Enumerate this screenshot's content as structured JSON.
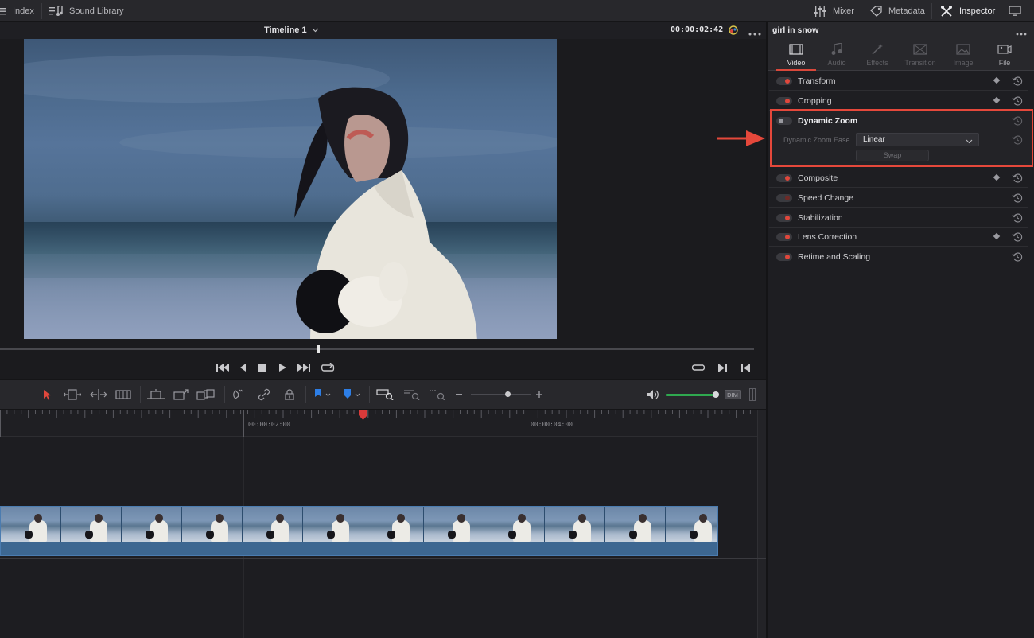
{
  "topbar": {
    "index_label": "Index",
    "sound_library_label": "Sound Library",
    "mixer_label": "Mixer",
    "metadata_label": "Metadata",
    "inspector_label": "Inspector"
  },
  "viewer": {
    "timeline_name": "Timeline 1",
    "timecode": "00:00:02:42"
  },
  "timeline": {
    "ruler_labels": [
      "00:00:02:00",
      "00:00:04:00"
    ]
  },
  "inspector": {
    "clip_name": "girl in snow",
    "tabs": [
      {
        "label": "Video",
        "active": true
      },
      {
        "label": "Audio",
        "active": false
      },
      {
        "label": "Effects",
        "active": false
      },
      {
        "label": "Transition",
        "active": false
      },
      {
        "label": "Image",
        "active": false
      },
      {
        "label": "File",
        "active": false
      }
    ],
    "sections": [
      {
        "label": "Transform"
      },
      {
        "label": "Cropping"
      },
      {
        "label": "Dynamic Zoom"
      },
      {
        "label": "Composite"
      },
      {
        "label": "Speed Change"
      },
      {
        "label": "Stabilization"
      },
      {
        "label": "Lens Correction"
      },
      {
        "label": "Retime and Scaling"
      }
    ],
    "dynamic_zoom": {
      "ease_label": "Dynamic Zoom Ease",
      "ease_value": "Linear",
      "swap_label": "Swap"
    }
  },
  "colors": {
    "accent_red": "#e5483b",
    "clip_blue": "#355c82",
    "audio_green": "#2fa84f"
  }
}
